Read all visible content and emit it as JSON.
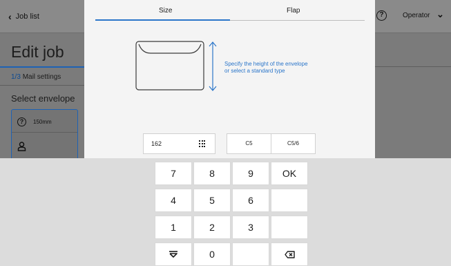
{
  "background": {
    "back_label": "Job list",
    "help_icon": "help-circle-icon",
    "operator_label": "Operator",
    "page_title": "Edit job",
    "step_number": "1/3",
    "step_label": "Mail settings",
    "select_envelope_label": "Select envelope",
    "panel_rows": [
      {
        "icon": "help-circle-icon",
        "label": "150mm"
      },
      {
        "icon": "user-icon",
        "label": ""
      }
    ]
  },
  "dialog": {
    "tabs": [
      {
        "label": "Size",
        "active": true
      },
      {
        "label": "Flap",
        "active": false
      }
    ],
    "instruction_line1": "Specify the height of the envelope",
    "instruction_line2": "or select a standard type",
    "height_value": "162",
    "standard_types": [
      "C5",
      "C5/6"
    ]
  },
  "keypad": {
    "keys": [
      [
        "7",
        "8",
        "9",
        "OK"
      ],
      [
        "4",
        "5",
        "6",
        ""
      ],
      [
        "1",
        "2",
        "3",
        ""
      ],
      [
        "hide-keyboard-icon",
        "0",
        "",
        "backspace-icon"
      ]
    ]
  },
  "colors": {
    "accent": "#2a75c9",
    "overlay": "#7b7b7b",
    "dialog_bg": "#f4f4f4",
    "keypad_bg": "#dcdcdc"
  }
}
